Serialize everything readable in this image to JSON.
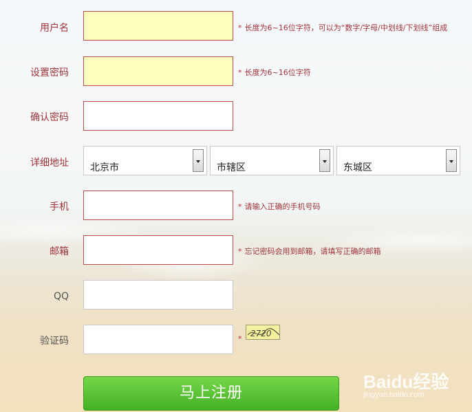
{
  "form": {
    "username": {
      "label": "用户名",
      "hint": "长度为6~16位字符，可以为“数字/字母/中划线/下划线”组成"
    },
    "password": {
      "label": "设置密码",
      "hint": "长度为6~16位字符"
    },
    "confirm": {
      "label": "确认密码"
    },
    "address": {
      "label": "详细地址",
      "province": "北京市",
      "city": "市辖区",
      "district": "东城区"
    },
    "phone": {
      "label": "手机",
      "hint": "请输入正确的手机号码"
    },
    "email": {
      "label": "邮箱",
      "hint": "忘记密码会用到邮箱，请填写正确的邮箱"
    },
    "qq": {
      "label": "QQ"
    },
    "captcha": {
      "label": "验证码",
      "code": "2720"
    },
    "submit_label": "马上注册"
  },
  "watermark": {
    "text": "Baidu经验",
    "url": "jingyan.baidu.com"
  },
  "colors": {
    "label": "#a0343a",
    "accent_green": "#4cb829",
    "input_yellow": "#ffffc0"
  }
}
